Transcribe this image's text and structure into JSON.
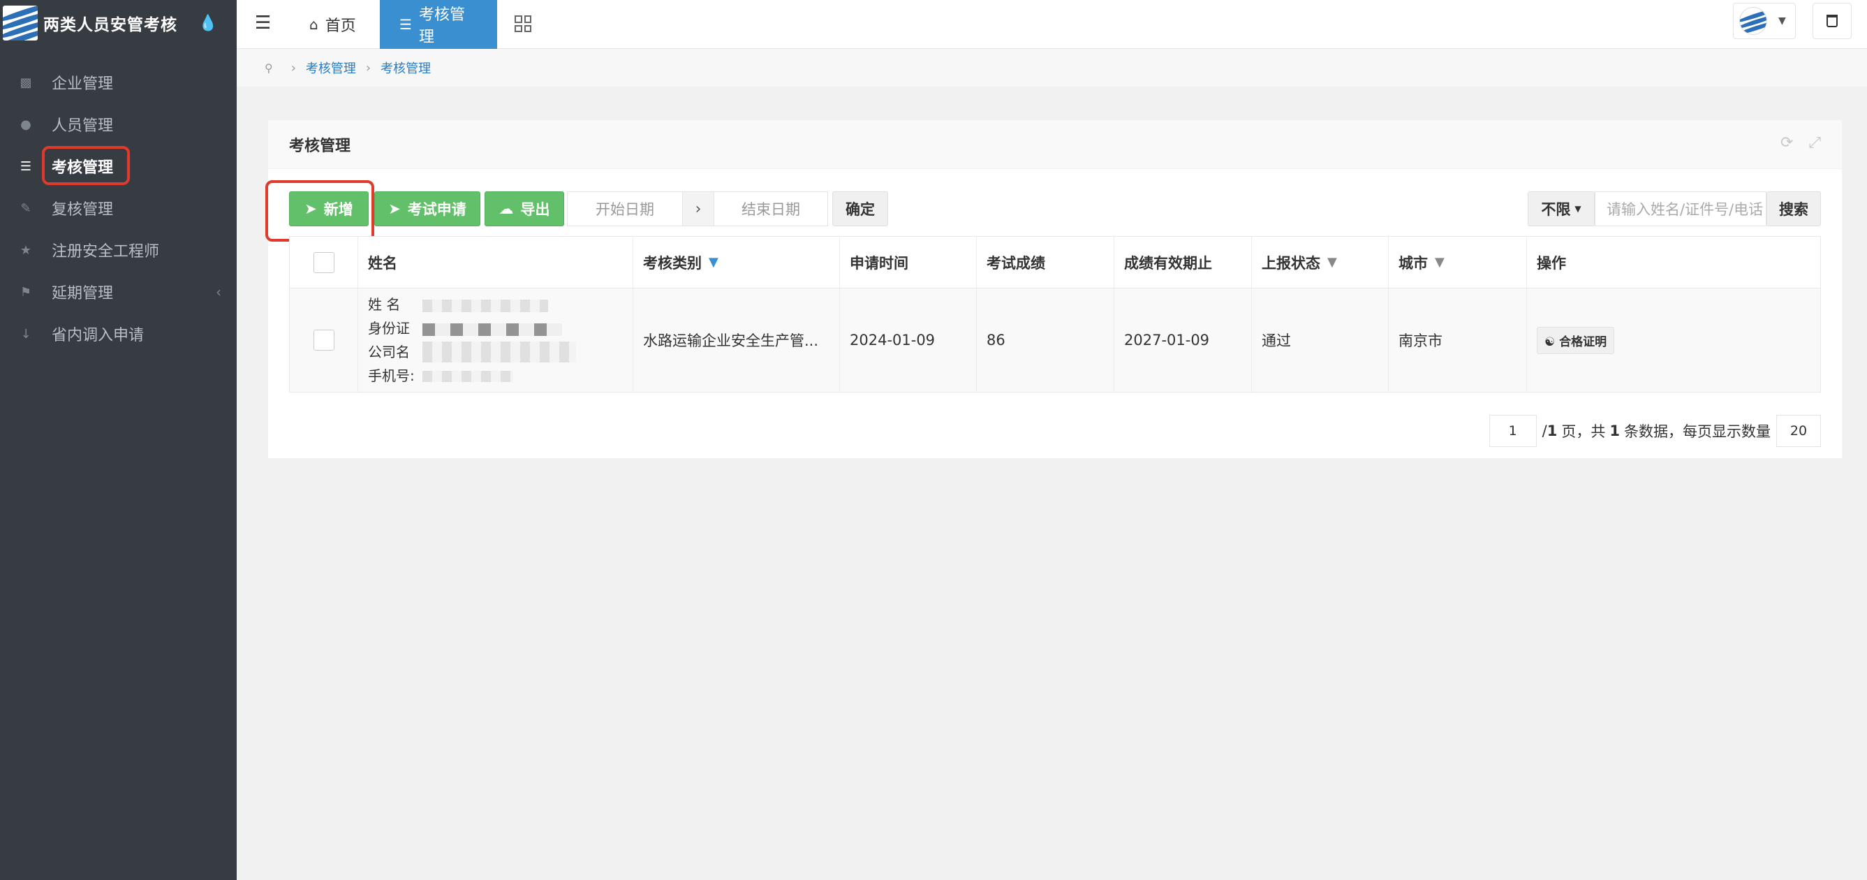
{
  "app": {
    "title": "两类人员安管考核"
  },
  "sidebar": {
    "items": [
      {
        "label": "企业管理",
        "icon": "sitemap-icon"
      },
      {
        "label": "人员管理",
        "icon": "user-icon"
      },
      {
        "label": "考核管理",
        "icon": "list-icon",
        "active": true
      },
      {
        "label": "复核管理",
        "icon": "stamp-icon"
      },
      {
        "label": "注册安全工程师",
        "icon": "trophy-icon"
      },
      {
        "label": "延期管理",
        "icon": "flag-icon",
        "has_children": true
      },
      {
        "label": "省内调入申请",
        "icon": "arrow-down-icon"
      }
    ]
  },
  "topbar": {
    "tabs": [
      {
        "label": "首页",
        "icon": "home-icon"
      },
      {
        "label": "考核管理",
        "icon": "list-icon",
        "active": true
      }
    ]
  },
  "breadcrumb": [
    "考核管理",
    "考核管理"
  ],
  "panel": {
    "title": "考核管理",
    "toolbar": {
      "add_label": "新增",
      "apply_label": "考试申请",
      "export_label": "导出",
      "start_date_placeholder": "开始日期",
      "end_date_placeholder": "结束日期",
      "confirm_label": "确定",
      "filter_select": "不限",
      "search_placeholder": "请输入姓名/证件号/电话",
      "search_label": "搜索"
    },
    "table": {
      "headers": [
        "姓名",
        "考核类别",
        "申请时间",
        "考试成绩",
        "成绩有效期止",
        "上报状态",
        "城市",
        "操作"
      ],
      "rows": [
        {
          "name_labels": [
            "姓 名",
            "身份证",
            "公司名",
            "手机号:"
          ],
          "category": "水路运输企业安全生产管...",
          "apply_date": "2024-01-09",
          "score": "86",
          "valid_until": "2027-01-09",
          "status": "通过",
          "city": "南京市",
          "action": "合格证明"
        }
      ]
    },
    "pager": {
      "current": "1",
      "total_pages": "1",
      "page_text": "页，共",
      "total_records": "1",
      "records_text": "条数据，每页显示数量",
      "page_size": "20"
    }
  },
  "colors": {
    "accent": "#3a8fd0",
    "green": "#63c06a",
    "highlight": "#e03a2c",
    "sidebar": "#363c42"
  }
}
